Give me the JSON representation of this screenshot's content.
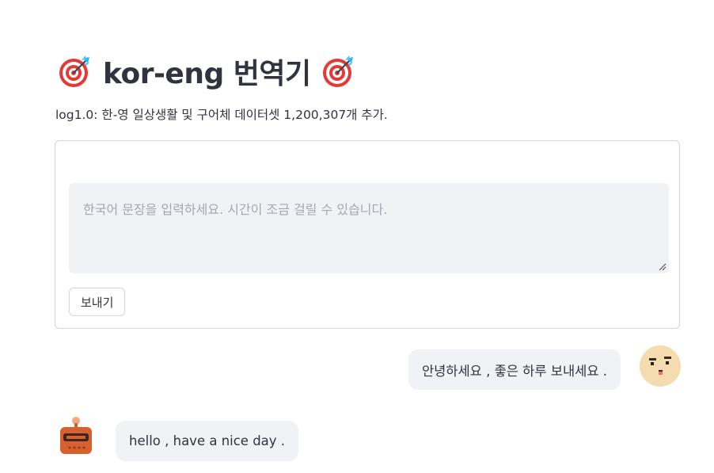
{
  "header": {
    "title": "kor-eng 번역기",
    "title_icon_left": "target-dart-icon",
    "title_icon_right": "target-dart-icon"
  },
  "subtitle": "log1.0: 한-영 일상생활 및 구어체 데이터셋 1,200,307개 추가.",
  "form": {
    "input_value": "",
    "input_placeholder": "한국어 문장을 입력하세요. 시간이 조금 걸릴 수 있습니다.",
    "send_label": "보내기"
  },
  "chat": {
    "messages": [
      {
        "role": "user",
        "text": "안녕하세요 , 좋은 하루 보내세요 .",
        "avatar_icon": "pixel-face-avatar-icon"
      },
      {
        "role": "bot",
        "text": "hello , have a nice day .",
        "avatar_icon": "robot-avatar-icon"
      }
    ]
  },
  "colors": {
    "text": "#31333f",
    "bubble_bg": "#f0f2f6",
    "border": "#d6d6d9",
    "placeholder": "#a3a8b4",
    "target_red": "#e53935",
    "dart_blue": "#29b6f6"
  }
}
